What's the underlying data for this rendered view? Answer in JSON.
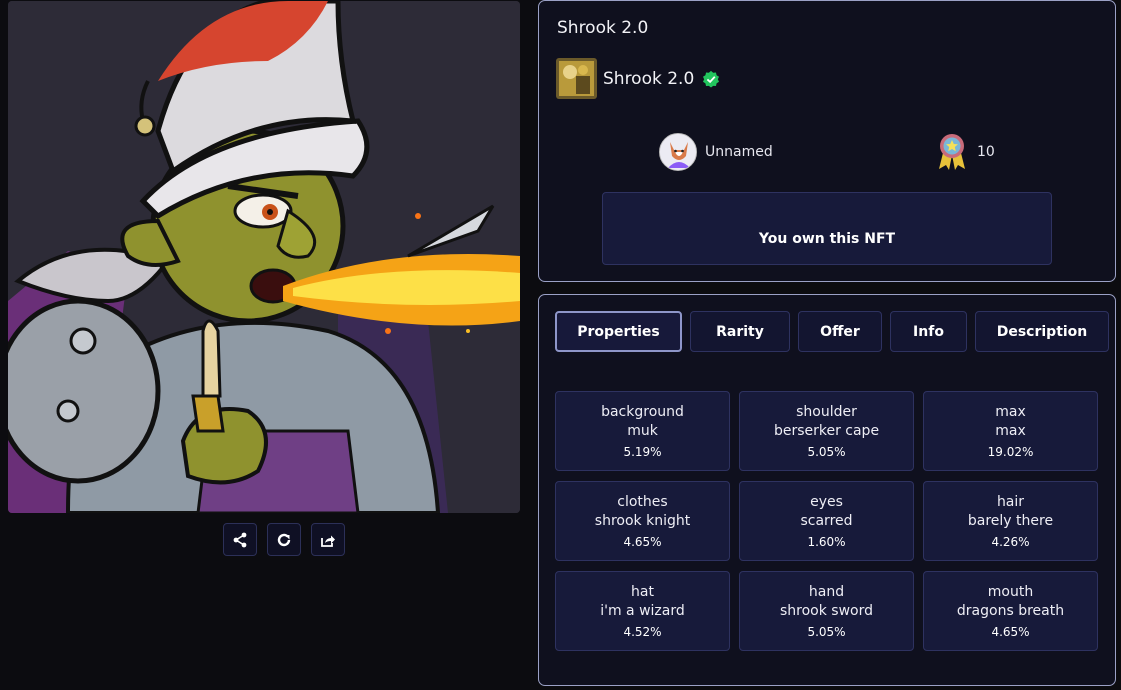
{
  "nft": {
    "title": "Shrook 2.0",
    "collection_name": "Shrook 2.0",
    "collection_verified": true,
    "owner_name": "Unnamed",
    "rank": "10",
    "ownership_message": "You own this NFT"
  },
  "tabs": [
    {
      "label": "Properties",
      "active": true
    },
    {
      "label": "Rarity",
      "active": false
    },
    {
      "label": "Offer",
      "active": false
    },
    {
      "label": "Info",
      "active": false
    },
    {
      "label": "Description",
      "active": false
    }
  ],
  "properties": [
    {
      "type": "background",
      "value": "muk",
      "percent": "5.19%"
    },
    {
      "type": "shoulder",
      "value": "berserker cape",
      "percent": "5.05%"
    },
    {
      "type": "max",
      "value": "max",
      "percent": "19.02%"
    },
    {
      "type": "clothes",
      "value": "shrook knight",
      "percent": "4.65%"
    },
    {
      "type": "eyes",
      "value": "scarred",
      "percent": "1.60%"
    },
    {
      "type": "hair",
      "value": "barely there",
      "percent": "4.26%"
    },
    {
      "type": "hat",
      "value": "i'm a wizard",
      "percent": "4.52%"
    },
    {
      "type": "hand",
      "value": "shrook sword",
      "percent": "5.05%"
    },
    {
      "type": "mouth",
      "value": "dragons breath",
      "percent": "4.65%"
    }
  ],
  "action_icons": [
    "share-icon",
    "refresh-icon",
    "external-share-icon"
  ],
  "colors": {
    "page_bg": "#0c0c10",
    "panel_bg": "#0f101e",
    "panel_border": "#9ba1c6",
    "card_bg": "#171a3a",
    "verified_green": "#22c55e"
  }
}
